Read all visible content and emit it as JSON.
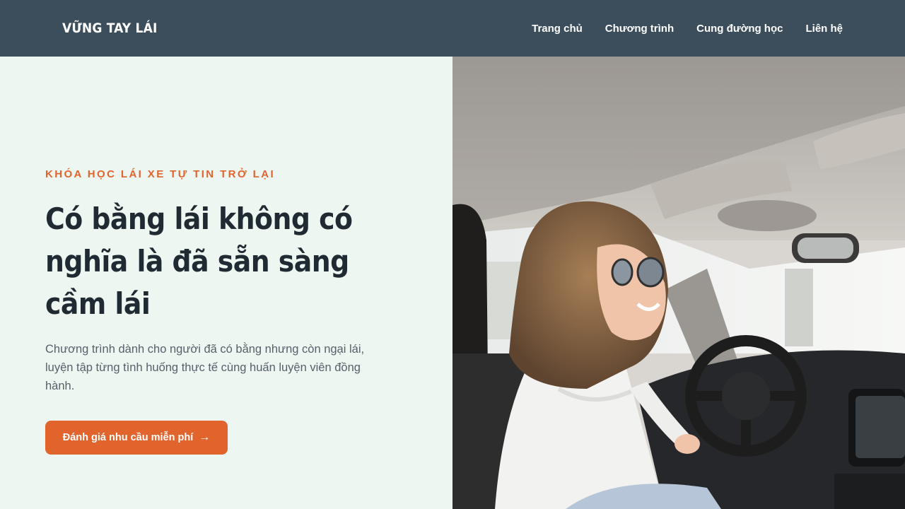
{
  "brand": {
    "logo_text": "VỮNG TAY LÁI"
  },
  "nav": {
    "items": [
      {
        "label": "Trang chủ"
      },
      {
        "label": "Chương trình"
      },
      {
        "label": "Cung đường học"
      },
      {
        "label": "Liên hệ"
      }
    ]
  },
  "hero": {
    "eyebrow": "KHÓA HỌC LÁI XE TỰ TIN TRỞ LẠI",
    "headline": "Có bằng lái không có nghĩa là đã sẵn sàng cầm lái",
    "description": "Chương trình dành cho người đã có bằng nhưng còn ngại lái, luyện tập từng tình huống thực tế cùng huấn luyện viên đồng hành.",
    "cta_label": "Đánh giá nhu cầu miễn phí",
    "cta_icon": "arrow-right-icon",
    "photo_subject": "woman-driving-car-photo"
  },
  "colors": {
    "nav_background": "#3c4d5c",
    "hero_background": "#eef6f1",
    "accent": "#e2642d",
    "headline": "#1f2a33",
    "body_text": "#55616b"
  }
}
